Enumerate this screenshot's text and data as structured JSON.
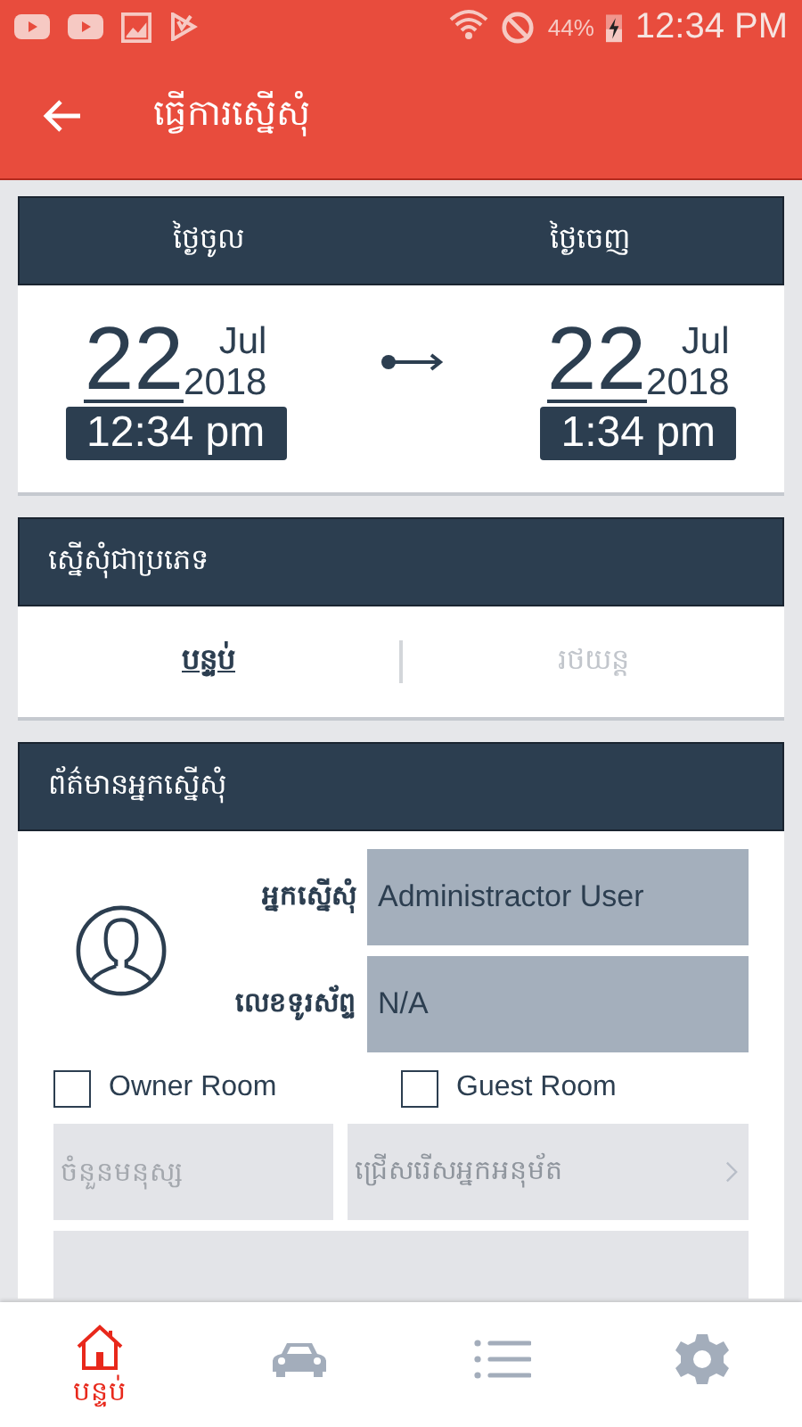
{
  "status_bar": {
    "battery": "44%",
    "time": "12:34 PM"
  },
  "app_bar": {
    "title": "ធ្វើការស្នើសុំ"
  },
  "dates": {
    "columns": [
      {
        "heading": "ថ្ងៃចូល",
        "day": "22",
        "month": "Jul",
        "year": "2018",
        "time": "12:34 pm"
      },
      {
        "heading": "ថ្ងៃចេញ",
        "day": "22",
        "month": "Jul",
        "year": "2018",
        "time": "1:34 pm"
      }
    ]
  },
  "request_type": {
    "heading": "ស្នើសុំជាប្រភេទ",
    "tabs": [
      {
        "label": "បន្ទប់",
        "selected": true
      },
      {
        "label": "រថយន្ត",
        "selected": false
      }
    ]
  },
  "requester": {
    "heading": "ព័ត៌មានអ្នកស្នើសុំ",
    "fields": [
      {
        "label": "អ្នកស្នើសុំ",
        "value": "Administractor User"
      },
      {
        "label": "លេខទូរស័ព្ទ",
        "value": "N/A"
      }
    ],
    "checkboxes": [
      {
        "label": "Owner Room",
        "checked": false
      },
      {
        "label": "Guest Room",
        "checked": false
      }
    ],
    "people": {
      "placeholder": "ចំនួនមនុស្ស"
    },
    "approver": {
      "placeholder": "ជ្រើសរើសអ្នកអនុម័ត"
    },
    "note": {
      "kind": "textarea"
    }
  },
  "bottom_nav": [
    {
      "kind": "home",
      "label": "បន្ទប់",
      "selected": true
    },
    {
      "kind": "car",
      "selected": false
    },
    {
      "kind": "list",
      "selected": false
    },
    {
      "kind": "settings",
      "selected": false
    }
  ]
}
